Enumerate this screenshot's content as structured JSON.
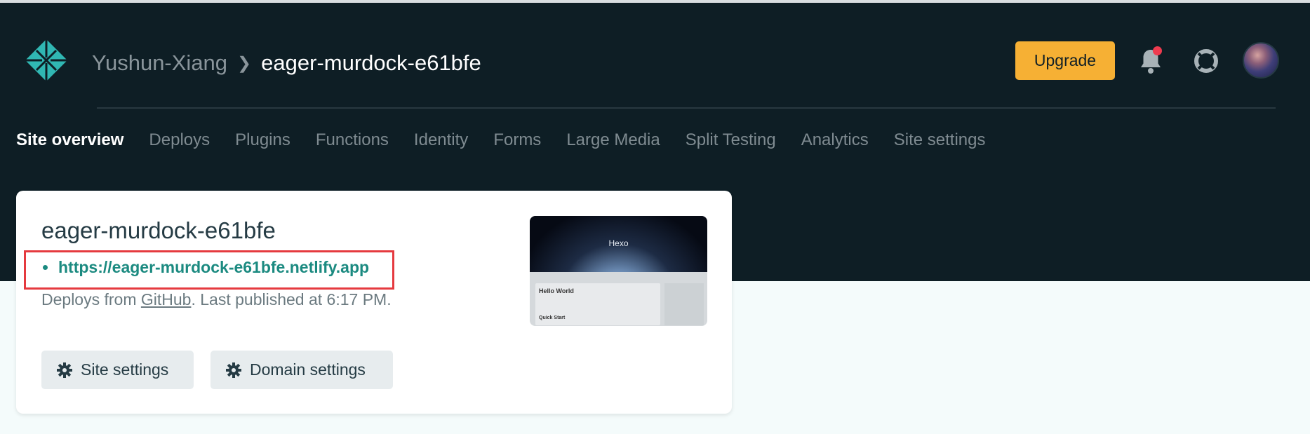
{
  "header": {
    "team_name": "Yushun-Xiang",
    "site_name": "eager-murdock-e61bfe",
    "upgrade_label": "Upgrade",
    "icons": [
      "netlify-logo",
      "chevron-right-icon",
      "bell-icon",
      "help-icon",
      "avatar"
    ],
    "accent_color": "#f6b034",
    "notification_dot_color": "#ee3b4f"
  },
  "nav": {
    "items": [
      {
        "label": "Site overview",
        "active": true
      },
      {
        "label": "Deploys"
      },
      {
        "label": "Plugins"
      },
      {
        "label": "Functions"
      },
      {
        "label": "Identity"
      },
      {
        "label": "Forms"
      },
      {
        "label": "Large Media"
      },
      {
        "label": "Split Testing"
      },
      {
        "label": "Analytics"
      },
      {
        "label": "Site settings"
      }
    ]
  },
  "card": {
    "site_name": "eager-murdock-e61bfe",
    "url": "https://eager-murdock-e61bfe.netlify.app",
    "deploy_prefix": "Deploys from ",
    "deploy_source": "GitHub",
    "deploy_suffix": ". Last published at 6:17 PM.",
    "site_settings_label": "Site settings",
    "domain_settings_label": "Domain settings",
    "link_color": "#1b8a80",
    "highlight_color": "#e53a3f"
  },
  "preview": {
    "title": "Hexo",
    "post_title": "Hello World",
    "post_footer": "Quick Start"
  }
}
